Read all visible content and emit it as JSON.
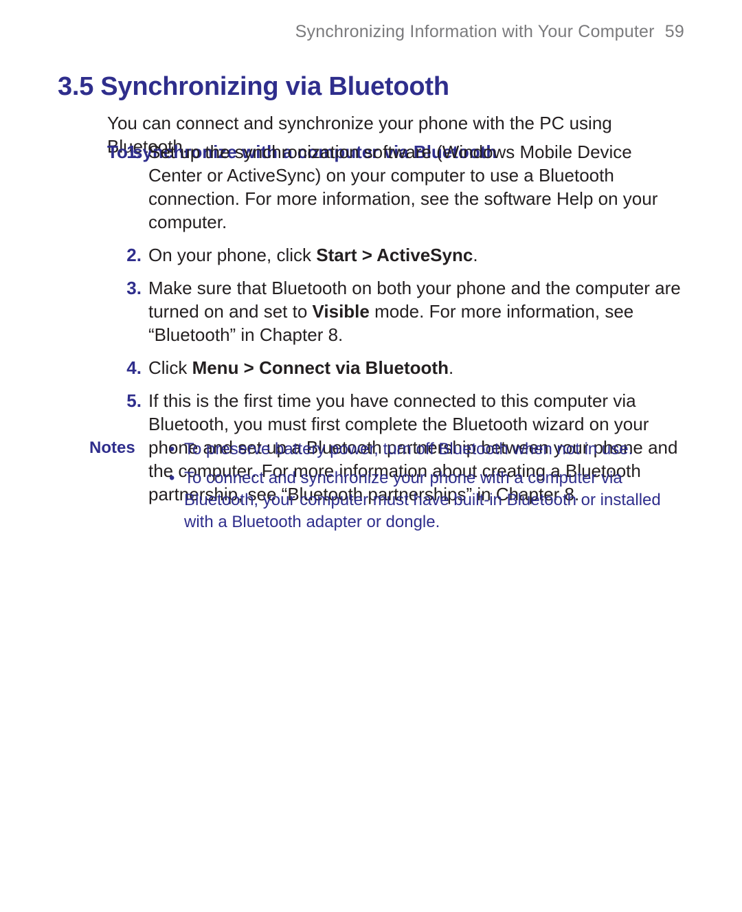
{
  "header": {
    "chapter_title": "Synchronizing Information with Your Computer",
    "page_number": "59"
  },
  "section": {
    "number": "3.5",
    "title": "Synchronizing via Bluetooth"
  },
  "intro": "You can connect and synchronize your phone with the PC using Bluetooth.",
  "subheading": "To synchronize with a computer via Bluetooth",
  "steps": [
    {
      "runs": [
        {
          "t": "Set up the synchronization software (Windows Mobile Device Center or ActiveSync) on your computer to use a Bluetooth connection. For more information, see the software Help on your computer."
        }
      ]
    },
    {
      "runs": [
        {
          "t": "On your phone, click "
        },
        {
          "t": "Start > ActiveSync",
          "b": true
        },
        {
          "t": "."
        }
      ]
    },
    {
      "runs": [
        {
          "t": "Make sure that Bluetooth on both your phone and the computer are turned on and set to "
        },
        {
          "t": "Visible",
          "b": true
        },
        {
          "t": " mode. For more information, see “Bluetooth” in Chapter 8."
        }
      ]
    },
    {
      "runs": [
        {
          "t": "Click "
        },
        {
          "t": "Menu > Connect via Bluetooth",
          "b": true
        },
        {
          "t": "."
        }
      ]
    },
    {
      "runs": [
        {
          "t": "If this is the first time you have connected to this computer via Bluetooth, you must first complete the Bluetooth wizard on your phone and set up a Bluetooth partnership between your phone and the computer. For more information about creating a Bluetooth partnership, see “Bluetooth partnerships” in Chapter 8."
        }
      ]
    }
  ],
  "notes": {
    "label": "Notes",
    "items": [
      "To preserve battery power, turn off Bluetooth when not in use.",
      "To connect and synchronize your phone with a computer via Bluetooth, your computer must have built-in Bluetooth or installed with a Bluetooth adapter or dongle."
    ]
  }
}
